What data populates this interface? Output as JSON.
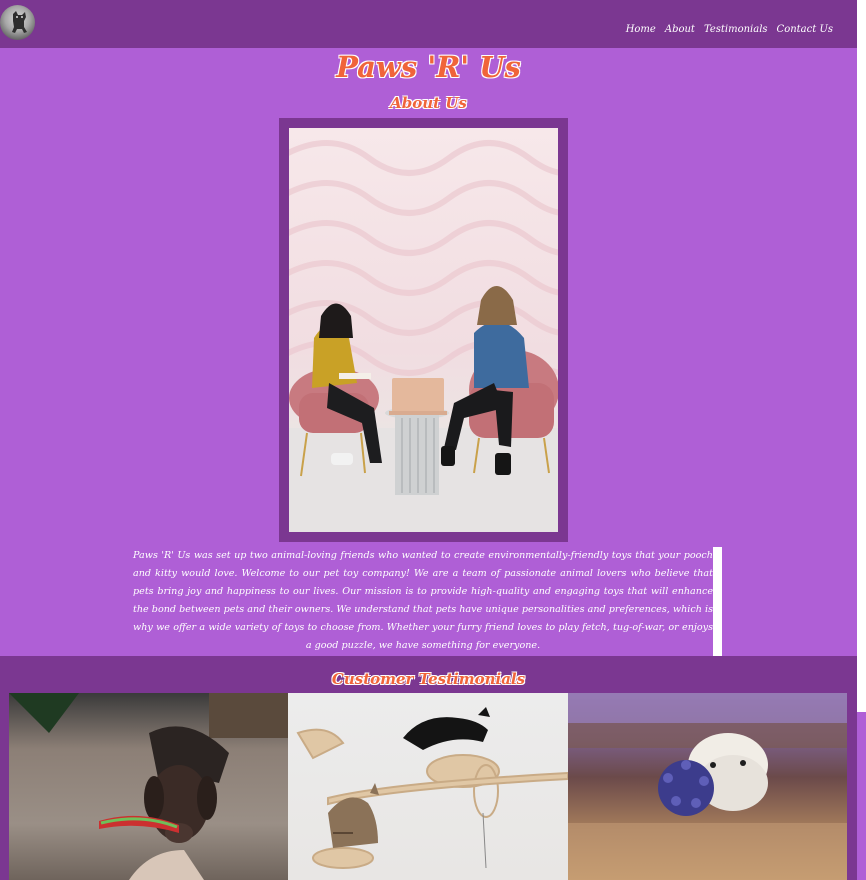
{
  "nav": {
    "logo_icon": "dog-logo-icon",
    "links": [
      "Home",
      "About",
      "Testimonials",
      "Contact Us"
    ]
  },
  "site": {
    "title": "Paws 'R' Us"
  },
  "about": {
    "heading": "About Us",
    "photo_icon": "two-women-meeting-photo",
    "text": "Paws 'R' Us was set up two animal-loving friends who wanted to create environmentally-friendly toys that your pooch and kitty would love. Welcome to our pet toy company! We are a team of passionate animal lovers who believe that pets bring joy and happiness to our lives. Our mission is to provide high-quality and engaging toys that will enhance the bond between pets and their owners. We understand that pets have unique personalities and preferences, which is why we offer a wide variety of toys to choose from. Whether your furry friend loves to play fetch, tug-of-war, or enjoys a good puzzle, we have something for everyone."
  },
  "testimonials": {
    "heading": "Customer Testimonials",
    "photos": [
      "dog-tug-toy-photo",
      "cats-climbing-shelves-photo",
      "puppy-ball-toy-photo"
    ]
  },
  "colors": {
    "page_bg": "#af5fd6",
    "bar_bg": "#7b3791",
    "heading": "#f0643a",
    "text": "#ffffff"
  }
}
